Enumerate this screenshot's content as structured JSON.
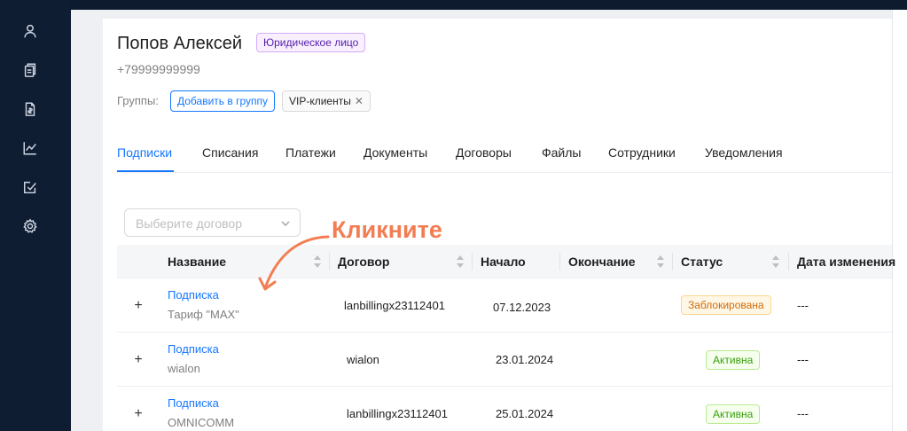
{
  "customer": {
    "name": "Попов Алексей",
    "type_badge": "Юридическое лицо",
    "phone": "+79999999999"
  },
  "groups": {
    "label": "Группы:",
    "add_button": "Добавить в группу",
    "tags": [
      "VIP-клиенты"
    ]
  },
  "tabs": [
    "Подписки",
    "Списания",
    "Платежи",
    "Документы",
    "Договоры",
    "Файлы",
    "Сотрудники",
    "Уведомления"
  ],
  "active_tab": "Подписки",
  "contract_select": {
    "placeholder": "Выберите договор"
  },
  "table": {
    "columns": [
      "Название",
      "Договор",
      "Начало",
      "Окончание",
      "Статус",
      "Дата изменения"
    ],
    "rows": [
      {
        "subscription": "Подписка",
        "tariff": "Тариф \"MAX\"",
        "contract": "lanbillingx23112401",
        "start": "07.12.2023",
        "status": "Заблокирована",
        "changed": "---"
      },
      {
        "subscription": "Подписка",
        "tariff": "wialon",
        "contract": "wialon",
        "start": "23.01.2024",
        "status": "Активна",
        "changed": "---"
      },
      {
        "subscription": "Подписка",
        "tariff": "OMNICOMM",
        "contract": "lanbillingx23112401",
        "start": "25.01.2024",
        "status": "Активна",
        "changed": "---"
      }
    ]
  },
  "annotation": {
    "text": "Кликните"
  },
  "icons": {
    "sidebar": [
      "user-icon",
      "documents-icon",
      "invoice-icon",
      "analytics-icon",
      "tasks-icon",
      "settings-icon"
    ],
    "expand": "plus-icon",
    "remove_tag": "close-icon"
  },
  "colors": {
    "sidebar": "#0f1d33",
    "accent": "#1677ff",
    "annotation": "#f27d52",
    "status_blocked": "#d46b08",
    "status_active": "#389e0d"
  }
}
